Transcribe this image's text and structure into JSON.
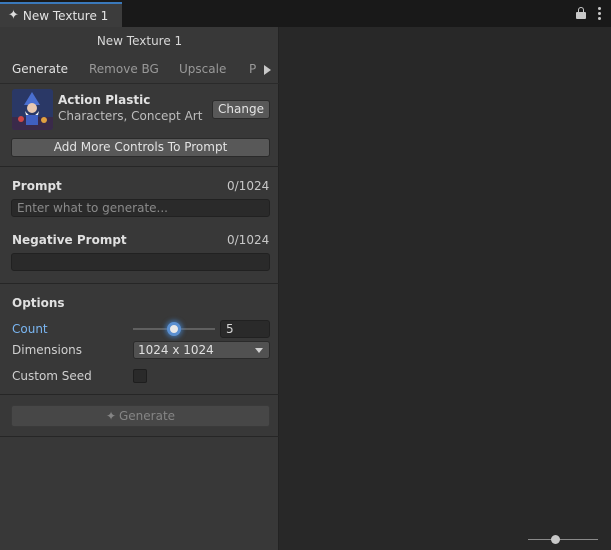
{
  "tab": {
    "title": "New Texture 1",
    "icon": "sparkle-icon"
  },
  "panel": {
    "title": "New Texture 1",
    "subtabs": [
      {
        "label": "Generate",
        "active": true
      },
      {
        "label": "Remove BG",
        "active": false
      },
      {
        "label": "Upscale",
        "active": false
      },
      {
        "label": "P",
        "active": false
      }
    ]
  },
  "model": {
    "name": "Action Plastic",
    "tags": "Characters, Concept Art",
    "change_label": "Change",
    "add_controls_label": "Add More Controls To Prompt"
  },
  "prompt": {
    "label": "Prompt",
    "counter": "0/1024",
    "value": "",
    "placeholder": "Enter what to generate..."
  },
  "negative_prompt": {
    "label": "Negative Prompt",
    "counter": "0/1024",
    "value": ""
  },
  "options": {
    "heading": "Options",
    "count_label": "Count",
    "count_value": "5",
    "count_slider_fraction": 0.5,
    "dimensions_label": "Dimensions",
    "dimensions_value": "1024 x 1024",
    "custom_seed_label": "Custom Seed",
    "custom_seed_checked": false
  },
  "generate_button": {
    "label": "Generate",
    "enabled": false
  },
  "colors": {
    "accent": "#3a79bb",
    "highlight_label": "#7ab6f2",
    "panel_bg": "#383838",
    "canvas_bg": "#282828"
  }
}
